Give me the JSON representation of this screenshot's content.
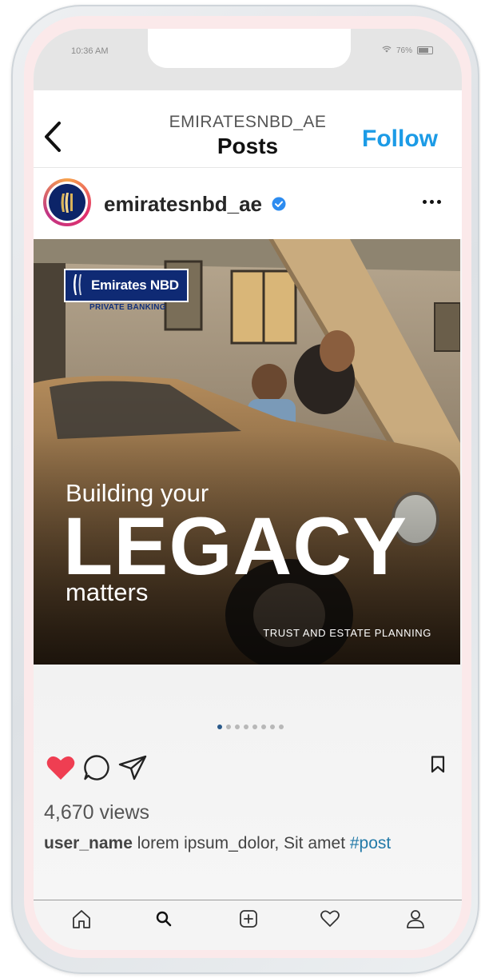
{
  "status_bar": {
    "time": "10:36 AM",
    "battery": "76%",
    "battery_level": 0.76
  },
  "header": {
    "account": "EMIRATESNBD_AE",
    "title": "Posts",
    "follow_label": "Follow"
  },
  "post": {
    "username": "emiratesnbd_ae",
    "verified": true,
    "image": {
      "brand_name": "Emirates NBD",
      "brand_sub": "PRIVATE BANKING",
      "line1": "Building your",
      "line2": "LEGACY",
      "line3": "matters",
      "tagline": "TRUST AND ESTATE PLANNING"
    },
    "carousel": {
      "count": 8,
      "active_index": 0
    },
    "views": "4,670 views",
    "caption": {
      "user": "user_name",
      "text": "lorem ipsum_dolor, Sit amet",
      "hashtag": "#post"
    },
    "liked": true
  },
  "nav": {
    "icons": [
      "home-icon",
      "search-icon",
      "add-post-icon",
      "activity-heart-icon",
      "profile-icon"
    ]
  },
  "colors": {
    "accent": "#1c9be6",
    "like": "#ef3e52",
    "hashtag": "#237aa8",
    "brand": "#0f2a74"
  }
}
